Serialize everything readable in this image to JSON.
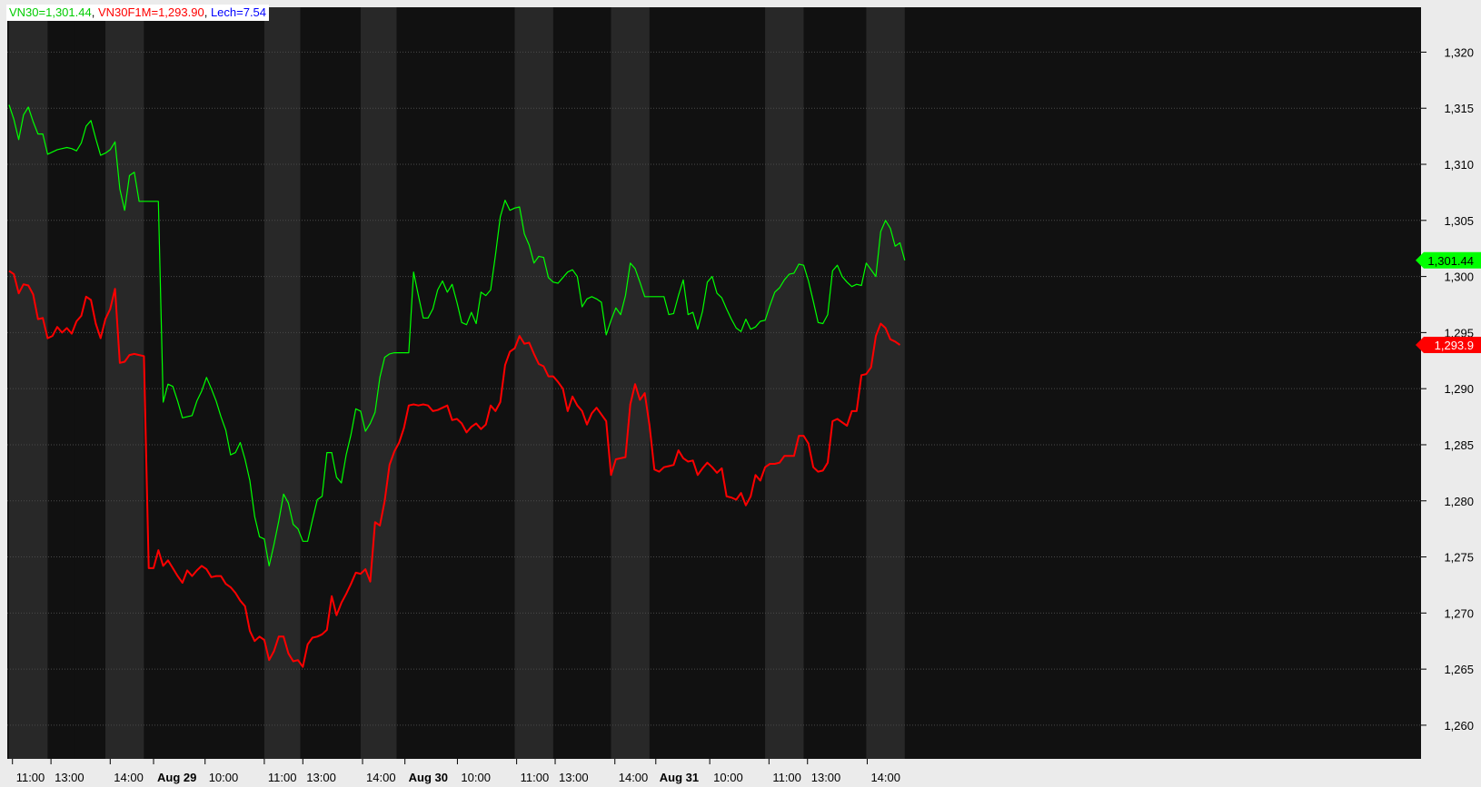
{
  "chart_data": {
    "type": "line",
    "ylim": [
      1257,
      1324
    ],
    "y_ticks": [
      1260,
      1265,
      1270,
      1275,
      1280,
      1285,
      1290,
      1295,
      1300,
      1305,
      1310,
      1315,
      1320
    ],
    "y_tick_labels": [
      "1,260",
      "1,265",
      "1,270",
      "1,275",
      "1,280",
      "1,285",
      "1,290",
      "1,295",
      "1,300",
      "1,305",
      "1,310",
      "1,315",
      "1,320"
    ],
    "x_tick_labels": [
      {
        "label": "11:00",
        "bar": 0.7,
        "bold": false
      },
      {
        "label": "13:00",
        "bar": 8.7,
        "bold": false
      },
      {
        "label": "14:00",
        "bar": 21.0,
        "bold": false
      },
      {
        "label": "Aug 29",
        "bar": 30.0,
        "bold": true
      },
      {
        "label": "10:00",
        "bar": 40.7,
        "bold": false
      },
      {
        "label": "11:00",
        "bar": 53.0,
        "bold": false
      },
      {
        "label": "13:00",
        "bar": 61.0,
        "bold": false
      },
      {
        "label": "14:00",
        "bar": 73.4,
        "bold": false
      },
      {
        "label": "Aug 30",
        "bar": 82.2,
        "bold": true
      },
      {
        "label": "10:00",
        "bar": 93.1,
        "bold": false
      },
      {
        "label": "11:00",
        "bar": 105.4,
        "bold": false
      },
      {
        "label": "13:00",
        "bar": 113.4,
        "bold": false
      },
      {
        "label": "14:00",
        "bar": 125.8,
        "bold": false
      },
      {
        "label": "Aug 31",
        "bar": 134.3,
        "bold": true
      },
      {
        "label": "10:00",
        "bar": 145.5,
        "bold": false
      },
      {
        "label": "11:00",
        "bar": 157.8,
        "bold": false
      },
      {
        "label": "13:00",
        "bar": 165.8,
        "bold": false
      },
      {
        "label": "14:00",
        "bar": 178.2,
        "bold": false
      }
    ],
    "session_bands": [
      [
        0,
        8
      ],
      [
        13.5,
        20
      ],
      [
        20,
        28
      ],
      [
        28,
        53
      ],
      [
        53,
        60.5
      ],
      [
        60.5,
        73
      ],
      [
        73,
        80.5
      ],
      [
        80.5,
        105
      ],
      [
        105,
        113
      ],
      [
        113,
        125
      ],
      [
        125,
        133
      ],
      [
        133,
        157
      ],
      [
        157,
        165
      ],
      [
        165,
        178
      ],
      [
        178,
        186
      ]
    ],
    "series": [
      {
        "name": "VN30",
        "color": "#00ff00",
        "last_label": "1,301.44",
        "values": [
          1315.3,
          1314.0,
          1312.2,
          1314.4,
          1315.1,
          1313.8,
          1312.7,
          1312.7,
          1310.9,
          1311.1,
          1311.3,
          1311.4,
          1311.5,
          1311.4,
          1311.2,
          1311.9,
          1313.4,
          1313.9,
          1312.3,
          1310.8,
          1311.0,
          1311.3,
          1312.0,
          1307.8,
          1305.9,
          1309.0,
          1309.3,
          1306.7,
          1306.7,
          1306.7,
          1306.7,
          1306.7,
          1288.8,
          1290.4,
          1290.2,
          1288.9,
          1287.4,
          1287.5,
          1287.6,
          1288.9,
          1289.8,
          1291.0,
          1290.0,
          1288.9,
          1287.5,
          1286.3,
          1284.1,
          1284.3,
          1285.2,
          1283.7,
          1281.8,
          1278.6,
          1276.8,
          1276.6,
          1274.2,
          1276.1,
          1278.2,
          1280.6,
          1279.8,
          1277.9,
          1277.5,
          1276.4,
          1276.4,
          1278.3,
          1280.1,
          1280.4,
          1284.3,
          1284.3,
          1282.1,
          1281.6,
          1284.1,
          1285.9,
          1288.2,
          1288.0,
          1286.2,
          1286.9,
          1287.9,
          1291.0,
          1292.8,
          1293.1,
          1293.2,
          1293.2,
          1293.2,
          1293.2,
          1300.4,
          1298.3,
          1296.3,
          1296.3,
          1297.1,
          1298.8,
          1299.6,
          1298.6,
          1299.3,
          1297.7,
          1295.9,
          1295.7,
          1296.8,
          1295.8,
          1298.6,
          1298.3,
          1298.8,
          1301.9,
          1305.3,
          1306.8,
          1305.9,
          1306.1,
          1306.2,
          1303.8,
          1302.8,
          1301.2,
          1301.8,
          1301.7,
          1299.9,
          1299.5,
          1299.4,
          1299.9,
          1300.4,
          1300.6,
          1300.0,
          1297.3,
          1298.0,
          1298.2,
          1298.0,
          1297.7,
          1294.8,
          1296.1,
          1297.2,
          1296.6,
          1298.3,
          1301.2,
          1300.7,
          1299.5,
          1298.2,
          1298.2,
          1298.2,
          1298.2,
          1298.2,
          1296.6,
          1296.7,
          1298.3,
          1299.7,
          1296.6,
          1296.8,
          1295.3,
          1296.9,
          1299.5,
          1300.0,
          1298.5,
          1298.1,
          1297.1,
          1296.2,
          1295.4,
          1295.1,
          1296.2,
          1295.3,
          1295.5,
          1296.0,
          1296.1,
          1297.4,
          1298.6,
          1299.0,
          1299.7,
          1300.2,
          1300.3,
          1301.1,
          1301.0,
          1299.6,
          1297.8,
          1295.9,
          1295.8,
          1296.6,
          1300.5,
          1301.0,
          1300.0,
          1299.5,
          1299.1,
          1299.3,
          1299.2,
          1301.2,
          1300.6,
          1300.0,
          1304.0,
          1305.0,
          1304.3,
          1302.7,
          1303.0,
          1301.44
        ]
      },
      {
        "name": "VN30F1M",
        "color": "#ff0000",
        "last_label": "1,293.9",
        "values": [
          1300.5,
          1300.2,
          1298.5,
          1299.3,
          1299.2,
          1298.4,
          1296.2,
          1296.3,
          1294.5,
          1294.7,
          1295.5,
          1295.0,
          1295.4,
          1294.9,
          1296.0,
          1296.5,
          1298.2,
          1297.9,
          1295.8,
          1294.5,
          1296.2,
          1297.1,
          1298.9,
          1292.3,
          1292.4,
          1293.0,
          1293.1,
          1293.0,
          1292.9,
          1274.0,
          1274.0,
          1275.6,
          1274.2,
          1274.7,
          1274.0,
          1273.3,
          1272.7,
          1273.8,
          1273.3,
          1273.8,
          1274.2,
          1273.9,
          1273.2,
          1273.3,
          1273.3,
          1272.6,
          1272.3,
          1271.8,
          1271.1,
          1270.6,
          1268.4,
          1267.5,
          1267.9,
          1267.6,
          1265.8,
          1266.6,
          1267.9,
          1267.9,
          1266.4,
          1265.7,
          1265.8,
          1265.2,
          1267.2,
          1267.8,
          1267.9,
          1268.1,
          1268.5,
          1271.5,
          1269.8,
          1270.9,
          1271.7,
          1272.6,
          1273.6,
          1273.5,
          1273.9,
          1272.8,
          1278.1,
          1277.8,
          1280.0,
          1283.2,
          1284.4,
          1285.2,
          1286.5,
          1288.5,
          1288.6,
          1288.5,
          1288.6,
          1288.5,
          1288.0,
          1288.1,
          1288.3,
          1288.5,
          1287.2,
          1287.3,
          1286.9,
          1286.1,
          1286.6,
          1286.9,
          1286.4,
          1286.8,
          1288.5,
          1288.0,
          1288.8,
          1292.1,
          1293.3,
          1293.6,
          1294.7,
          1294.0,
          1294.1,
          1293.1,
          1292.2,
          1292.0,
          1291.1,
          1291.1,
          1290.6,
          1290.0,
          1288.0,
          1289.3,
          1288.5,
          1288.0,
          1286.8,
          1287.8,
          1288.3,
          1287.7,
          1287.1,
          1282.3,
          1283.7,
          1283.8,
          1283.9,
          1288.6,
          1290.4,
          1289.0,
          1289.6,
          1286.7,
          1282.8,
          1282.6,
          1283.0,
          1283.1,
          1283.2,
          1284.5,
          1283.8,
          1283.5,
          1283.6,
          1282.3,
          1282.9,
          1283.4,
          1283.0,
          1282.5,
          1282.9,
          1280.4,
          1280.3,
          1280.1,
          1280.7,
          1279.6,
          1280.4,
          1282.3,
          1281.8,
          1283.0,
          1283.3,
          1283.3,
          1283.4,
          1284.0,
          1284.0,
          1284.0,
          1285.8,
          1285.8,
          1285.1,
          1283.0,
          1282.6,
          1282.7,
          1283.4,
          1287.1,
          1287.3,
          1287.0,
          1286.7,
          1288.0,
          1288.0,
          1291.2,
          1291.3,
          1291.9,
          1294.7,
          1295.8,
          1295.4,
          1294.4,
          1294.2,
          1293.9
        ]
      }
    ]
  },
  "legend": {
    "vn30": "VN30=1,301.44",
    "vn30f1m": "VN30F1M=1,293.90",
    "lech": "Lech=7.54",
    "separator": ","
  },
  "colors": {
    "vn30": "#00ff00",
    "vn30f1m": "#ff0000",
    "lech": "#0000ff",
    "band_dark": "#111111",
    "band_light": "#282828",
    "axis_bg": "#ebebeb",
    "grid": "#4a4a4a"
  }
}
